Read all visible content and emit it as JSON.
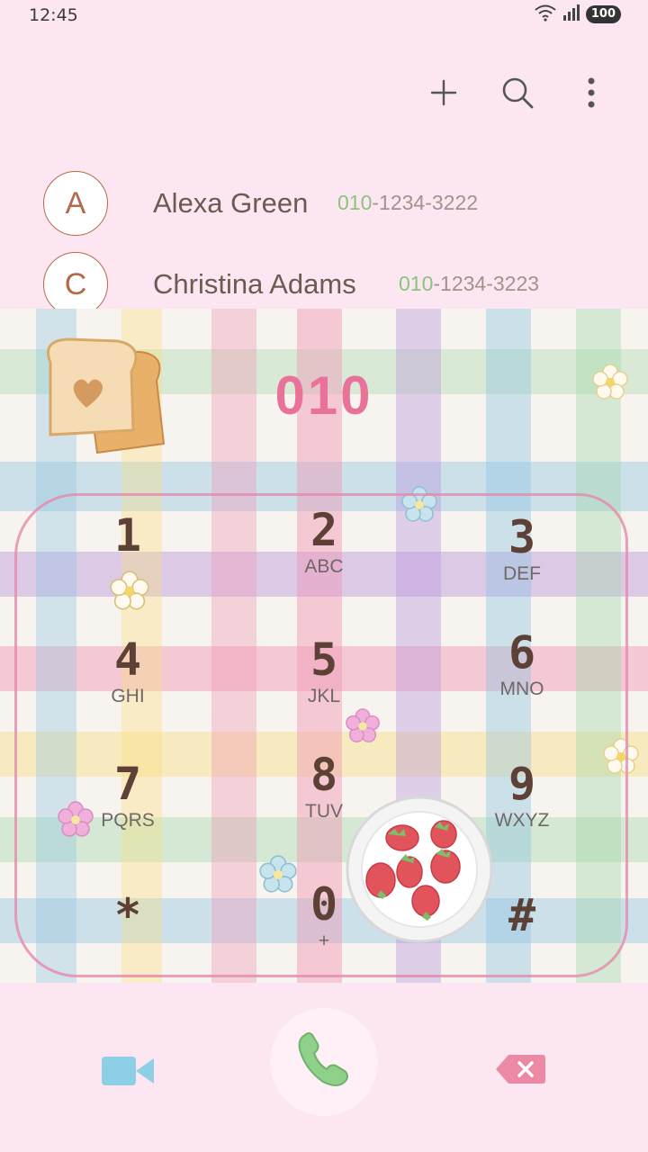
{
  "status_bar": {
    "time": "12:45",
    "battery": "100"
  },
  "contacts": [
    {
      "initial": "A",
      "name": "Alexa Green",
      "number_match": "010",
      "number_rest": "-1234-3222"
    },
    {
      "initial": "C",
      "name": "Christina Adams",
      "number_match": "010",
      "number_rest": "-1234-3223"
    }
  ],
  "dial_input": "010",
  "keypad": [
    {
      "digit": "1",
      "letters": ""
    },
    {
      "digit": "2",
      "letters": "ABC"
    },
    {
      "digit": "3",
      "letters": "DEF"
    },
    {
      "digit": "4",
      "letters": "GHI"
    },
    {
      "digit": "5",
      "letters": "JKL"
    },
    {
      "digit": "6",
      "letters": "MNO"
    },
    {
      "digit": "7",
      "letters": "PQRS"
    },
    {
      "digit": "8",
      "letters": "TUV"
    },
    {
      "digit": "9",
      "letters": "WXYZ"
    },
    {
      "digit": "*",
      "letters": ""
    },
    {
      "digit": "0",
      "letters": "+"
    },
    {
      "digit": "#",
      "letters": ""
    }
  ],
  "icons": {
    "add": "plus-icon",
    "search": "search-icon",
    "more": "more-vertical-icon",
    "video_call": "video-camera-icon",
    "call": "phone-icon",
    "backspace": "backspace-icon"
  },
  "colors": {
    "accent_pink": "#e9729b",
    "match_green": "#8cc47a",
    "call_green": "#8fd08a",
    "video_blue": "#8dd0e6",
    "background": "#fbe6f2"
  }
}
